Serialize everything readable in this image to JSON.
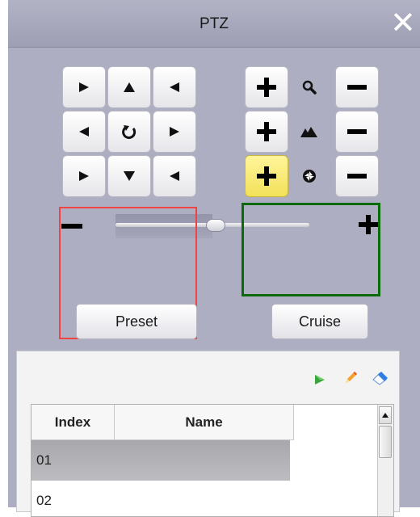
{
  "window": {
    "title": "PTZ",
    "close_glyph": "✕"
  },
  "direction_pad": {
    "buttons": [
      "up-left",
      "up",
      "up-right",
      "left",
      "auto-rotate",
      "right",
      "down-left",
      "down",
      "down-right"
    ]
  },
  "lens_controls": {
    "rows": [
      {
        "name": "zoom",
        "icon": "magnifier-icon"
      },
      {
        "name": "focus",
        "icon": "mountain-icon"
      },
      {
        "name": "iris",
        "icon": "aperture-icon"
      }
    ],
    "highlight_color": "#f5e96a"
  },
  "speed_slider": {
    "value_fraction": 0.47
  },
  "annotations": {
    "red_box_color": "#f04444",
    "green_box_color": "#0b6b0b"
  },
  "tabs": {
    "preset": "Preset",
    "cruise": "Cruise"
  },
  "preset_toolbar": {
    "icons": [
      "play-icon",
      "edit-pencil-icon",
      "eraser-icon"
    ]
  },
  "preset_table": {
    "headers": {
      "index": "Index",
      "name": "Name"
    },
    "rows": [
      {
        "index": "01",
        "name": ""
      },
      {
        "index": "02",
        "name": ""
      }
    ]
  }
}
